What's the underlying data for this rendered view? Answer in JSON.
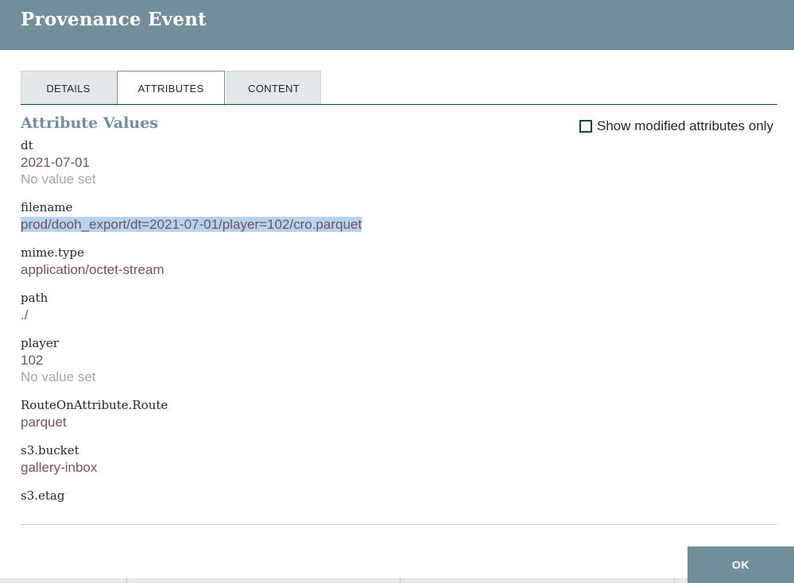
{
  "dialog": {
    "title": "Provenance Event"
  },
  "tabs": [
    {
      "label": "DETAILS",
      "active": false
    },
    {
      "label": "ATTRIBUTES",
      "active": true
    },
    {
      "label": "CONTENT",
      "active": false
    }
  ],
  "attributes_panel": {
    "title": "Attribute Values",
    "modified_only_label": "Show modified attributes only",
    "modified_only_checked": false
  },
  "attributes": [
    {
      "name": "dt",
      "value": "2021-07-01",
      "previous": "No value set"
    },
    {
      "name": "filename",
      "value": "prod/dooh_export/dt=2021-07-01/player=102/cro.parquet"
    },
    {
      "name": "mime.type",
      "value": "application/octet-stream"
    },
    {
      "name": "path",
      "value": "./"
    },
    {
      "name": "player",
      "value": "102",
      "previous": "No value set"
    },
    {
      "name": "RouteOnAttribute.Route",
      "value": "parquet"
    },
    {
      "name": "s3.bucket",
      "value": "gallery-inbox"
    },
    {
      "name": "s3.etag"
    }
  ],
  "footer": {
    "ok_label": "OK"
  },
  "colors": {
    "header": "#728e9b",
    "accent_dark": "#004849",
    "value_text": "#775351",
    "muted_text": "#a4a4a4"
  }
}
